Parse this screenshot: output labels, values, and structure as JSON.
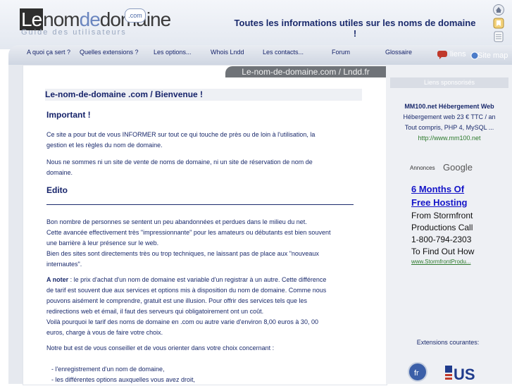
{
  "header": {
    "logo_prefix": "Le",
    "logo_nom": "nom",
    "logo_de": "de",
    "logo_domaine": "domaine",
    "logo_bubble": ".com",
    "tagline": "Guide des utilisateurs",
    "headline": "Toutes les informations utiles sur les noms de domaine !"
  },
  "nav": {
    "items": [
      "A quoi ça sert ?",
      "Quelles extensions ?",
      "Les options...",
      "Whois Lndd",
      "Les contacts...",
      "Forum",
      "Glossaire"
    ],
    "liens": "liens",
    "site_map": "Site map"
  },
  "main": {
    "domain_tab": "Le-nom-de-domaine.com / Lndd.fr",
    "page_title": "Le-nom-de-domaine .com / Bienvenue !",
    "important_heading": "Important !",
    "para1_line1": "Ce site a pour but de vous INFORMER sur tout ce qui touche de près ou de loin à l'utilisation, la",
    "para1_line2": "gestion et les règles du nom de domaine.",
    "para2_line1": "Nous ne sommes ni un site de vente de noms de domaine, ni un site de réservation de nom de",
    "para2_line2": "domaine.",
    "edito_heading": "Edito",
    "para3": [
      "Bon nombre de personnes se sentent un peu abandonnées et perdues dans le milieu du net.",
      "Cette avancée effectivement très \"impressionnante\" pour les amateurs ou débutants est bien souvent",
      "une barrière à leur présence sur le web.",
      "Bien des sites sont directements très ou trop techniques, ne laissant pas de place aux \"nouveaux",
      "internautes\"."
    ],
    "a_noter_label": "A noter",
    "para4": [
      " : le prix d'achat d'un nom de domaine est variable d'un registrar à un autre. Cette différence",
      "de tarif est souvent due aux services et options mis à disposition du nom de domaine. Comme nous",
      "pouvons aisément le comprendre, gratuit est une illusion. Pour offrir des services tels que les",
      "redirections web et émail, il faut des serveurs qui obligatoirement ont un coût.",
      "Voilà pourquoi le tarif des noms de domaine en .com ou autre varie d'environ 8,00 euros à 30, 00",
      "euros, charge à vous de faire votre choix."
    ],
    "para5": "Notre but est de vous conseiller et de vous orienter dans votre choix concernant :",
    "list": [
      "- l'enregistrement d'un nom de domaine,",
      "- les différentes options auxquelles vous avez droit,"
    ]
  },
  "right": {
    "sponsor_header": "Liens sponsorisés",
    "ad1": {
      "title": "MM100.net Hébergement Web",
      "line1": "Hébergement web 23 € TTC / an",
      "line2": "Tout compris, PHP 4, MySQL ...",
      "url": "http://www.mm100.net"
    },
    "annonces": "Annonces",
    "google": "Google",
    "ad2": {
      "title1": "6 Months Of",
      "title2": "Free Hosting",
      "line1": "From Stormfront",
      "line2": "Productions Call",
      "line3": "1-800-794-2303",
      "line4": "To Find Out How",
      "url": "www.StormfrontProdu..."
    },
    "extensions_label": "Extensions courantes:",
    "ext_us": "US"
  },
  "colors": {
    "accent": "#1a2a6c",
    "link": "#1414c8",
    "url_green": "#2d7a2d"
  }
}
